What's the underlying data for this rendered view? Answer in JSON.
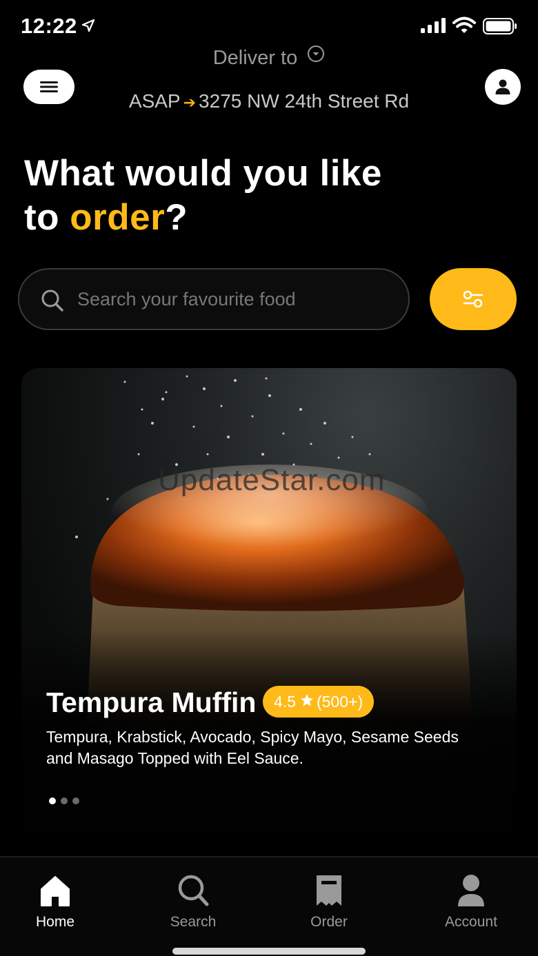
{
  "status_bar": {
    "time": "12:22"
  },
  "header": {
    "deliver_label": "Deliver to",
    "schedule": "ASAP",
    "address": "3275 NW 24th Street Rd"
  },
  "headline": {
    "line1": "What would you like",
    "line2_prefix": "to ",
    "accent": "order",
    "line2_suffix": "?"
  },
  "search": {
    "placeholder": "Search your favourite food"
  },
  "colors": {
    "accent": "#FFBA19",
    "background": "#000000"
  },
  "featured": {
    "watermark": "UpdateStar.com",
    "title": "Tempura Muffin",
    "rating": "4.5",
    "rating_count": "(500+)",
    "description": "Tempura, Krabstick, Avocado, Spicy Mayo, Sesame Seeds and Masago Topped with Eel Sauce.",
    "carousel": {
      "total": 3,
      "active_index": 0
    }
  },
  "nav": {
    "items": [
      {
        "label": "Home",
        "icon": "home-icon",
        "active": true
      },
      {
        "label": "Search",
        "icon": "search-icon",
        "active": false
      },
      {
        "label": "Order",
        "icon": "receipt-icon",
        "active": false
      },
      {
        "label": "Account",
        "icon": "person-icon",
        "active": false
      }
    ]
  }
}
